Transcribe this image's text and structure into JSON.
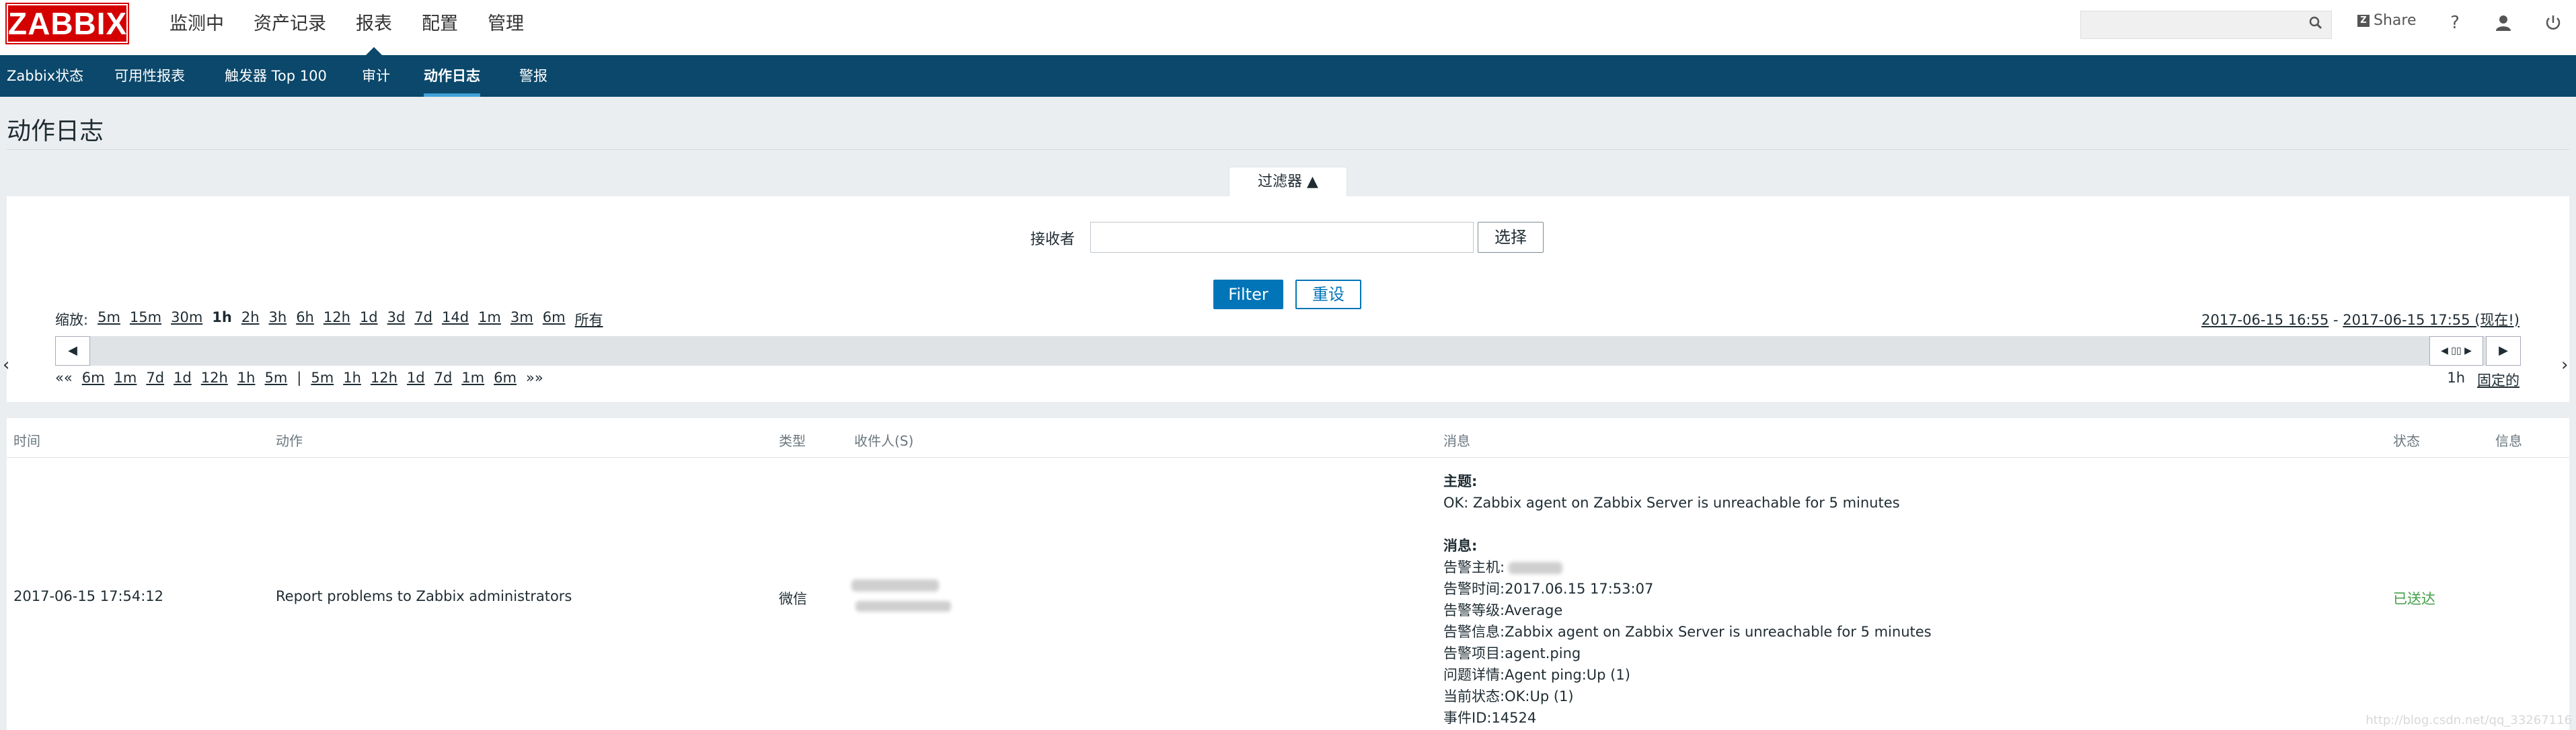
{
  "header": {
    "logo": "ZABBIX",
    "menu": [
      "监测中",
      "资产记录",
      "报表",
      "配置",
      "管理"
    ],
    "active_menu": "报表",
    "share_label": "Share",
    "help_label": "?"
  },
  "subnav": {
    "items": [
      "Zabbix状态",
      "可用性报表",
      "触发器 Top 100",
      "审计",
      "动作日志",
      "警报"
    ],
    "active": "动作日志"
  },
  "page": {
    "title": "动作日志"
  },
  "filter": {
    "tab_label": "过滤器 ▲",
    "recipient_label": "接收者",
    "recipient_value": "",
    "select_button": "选择",
    "filter_button": "Filter",
    "reset_button": "重设"
  },
  "timeline": {
    "zoom_label": "缩放:",
    "zoom_options": [
      "5m",
      "15m",
      "30m",
      "1h",
      "2h",
      "3h",
      "6h",
      "12h",
      "1d",
      "3d",
      "7d",
      "14d",
      "1m",
      "3m",
      "6m",
      "所有"
    ],
    "zoom_selected": "1h",
    "range_from": "2017-06-15 16:55",
    "range_sep": " - ",
    "range_to": "2017-06-15 17:55 (现在!)",
    "back_label": "««",
    "back_steps": [
      "6m",
      "1m",
      "7d",
      "1d",
      "12h",
      "1h",
      "5m"
    ],
    "nav_sep": "|",
    "fwd_steps": [
      "5m",
      "1h",
      "12h",
      "1d",
      "7d",
      "1m",
      "6m"
    ],
    "fwd_label": "»»",
    "period": "1h",
    "fixed_label": "固定的"
  },
  "table": {
    "columns": [
      "时间",
      "动作",
      "类型",
      "收件人(S)",
      "消息",
      "状态",
      "信息"
    ],
    "row": {
      "time": "2017-06-15 17:54:12",
      "action": "Report problems to Zabbix administrators",
      "type": "微信",
      "subject_label": "主题:",
      "subject": "OK: Zabbix agent on Zabbix Server is unreachable for 5 minutes",
      "message_label": "消息:",
      "lines": [
        "告警主机:",
        "告警时间:2017.06.15 17:53:07",
        "告警等级:Average",
        "告警信息:Zabbix agent on Zabbix Server is unreachable for 5 minutes",
        "告警项目:agent.ping",
        "问题详情:Agent ping:Up (1)",
        "当前状态:OK:Up (1)",
        "事件ID:14524"
      ],
      "status": "已送达"
    }
  },
  "watermark": "http://blog.csdn.net/qq_33267116",
  "colors": {
    "brand": "#d40000",
    "nav_bg": "#0b486b",
    "primary": "#0275b8",
    "success": "#429e47"
  }
}
